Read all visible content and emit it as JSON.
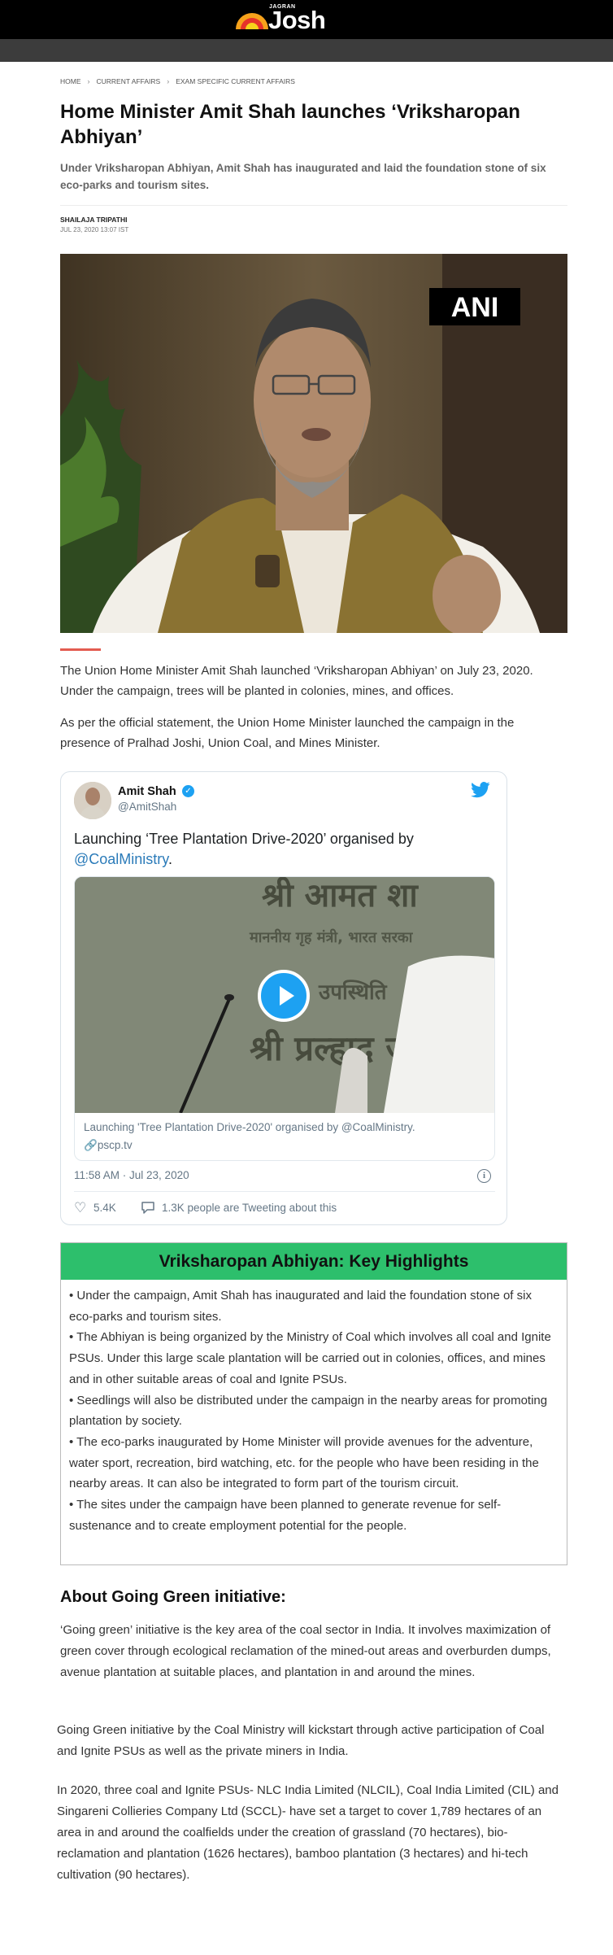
{
  "header": {
    "logo_small": "JAGRAN",
    "logo_main": "Josh"
  },
  "breadcrumb": [
    "HOME",
    "CURRENT AFFAIRS",
    "EXAM SPECIFIC CURRENT AFFAIRS"
  ],
  "article": {
    "title": "Home Minister Amit Shah launches ‘Vriksharopan Abhiyan’",
    "summary": "Under Vriksharopan Abhiyan, Amit Shah has inaugurated and laid the foundation stone of six eco-parks and tourism sites.",
    "author": "SHAILAJA TRIPATHI",
    "date": "JUL 23, 2020 13:07 IST",
    "image_watermark": "ANI",
    "paragraphs": [
      "The Union Home Minister Amit Shah launched ‘Vriksharopan Abhiyan’ on July 23, 2020. Under the campaign, trees will be planted in colonies, mines, and offices.",
      "As per the official statement, the Union Home Minister launched the campaign in the presence of Pralhad Joshi, Union Coal, and Mines Minister."
    ]
  },
  "tweet": {
    "name": "Amit Shah",
    "verified_mark": "✓",
    "handle": "@AmitShah",
    "text_before": "Launching ‘Tree Plantation Drive-2020’ organised by ",
    "mention": "@CoalMinistry",
    "text_after": ".",
    "card_title": "Launching 'Tree Plantation Drive-2020' organised by @CoalMinistry.",
    "card_link": "pscp.tv",
    "video_text_line1": "श्री आमत शा",
    "video_text_line2": "माननीय गृह मंत्री, भारत सरका",
    "video_text_line3": "उपस्थिति",
    "video_text_line4": "श्री प्रल्हाद ज",
    "timestamp": "11:58 AM · Jul 23, 2020",
    "likes": "5.4K",
    "talking": "1.3K people are Tweeting about this",
    "icons": {
      "bird": "twitter-bird-icon",
      "play": "play-icon",
      "like": "heart-icon",
      "reply": "speech-bubble-icon",
      "info": "info-icon",
      "link": "link-icon"
    },
    "colors": {
      "accent": "#1da1f2",
      "mention": "#2b7bb9"
    }
  },
  "highlights": {
    "heading": "Vriksharopan Abhiyan: Key Highlights",
    "items": [
      "• Under the campaign, Amit Shah has inaugurated and laid the foundation stone of six eco-parks and tourism sites.",
      "• The Abhiyan is being organized by the Ministry of Coal which involves all coal and Ignite PSUs. Under this large scale plantation will be carried out in colonies, offices, and mines and in other suitable areas of coal and Ignite PSUs.",
      "• Seedlings will also be distributed under the campaign in the nearby areas for promoting plantation by society.",
      "• The eco-parks inaugurated by Home Minister will provide avenues for the adventure, water sport, recreation, bird watching, etc. for the people who have been residing in the nearby areas. It can also be integrated to form part of the tourism circuit.",
      "• The sites under the campaign have been planned to generate revenue for self-sustenance and to create employment potential for the people."
    ],
    "header_color": "#2dbf6c"
  },
  "going_green": {
    "heading": "About Going Green initiative:",
    "paragraphs": [
      "‘Going green’ initiative is the key area of the coal sector in India. It involves maximization of green cover through ecological reclamation of the mined-out areas and overburden dumps, avenue plantation at suitable places, and plantation in and around the mines.",
      "Going Green initiative by the Coal Ministry will kickstart through active participation of Coal and Ignite PSUs as well as the private miners in India.",
      "In 2020, three coal and Ignite PSUs- NLC India Limited (NLCIL), Coal India Limited (CIL) and Singareni Collieries Company Ltd (SCCL)- have set a target to cover 1,789 hectares of an area in and around the coalfields under the creation of grassland (70 hectares), bio-reclamation and plantation (1626 hectares), bamboo plantation (3 hectares) and hi-tech cultivation (90 hectares)."
    ]
  }
}
